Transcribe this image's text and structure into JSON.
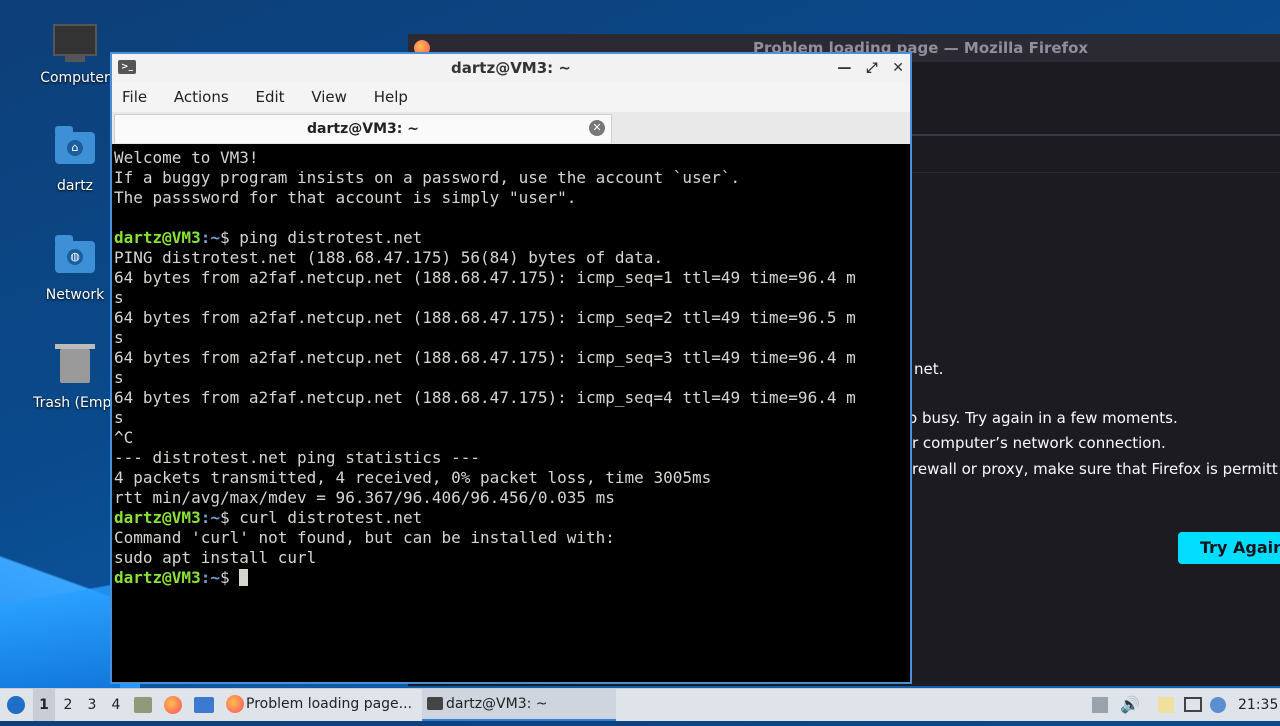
{
  "desktop": {
    "icons": [
      {
        "label": "Computer"
      },
      {
        "label": "dartz"
      },
      {
        "label": "Network"
      },
      {
        "label": "Trash (Empt"
      }
    ]
  },
  "firefox": {
    "title": "Problem loading page — Mozilla Firefox",
    "lines": [
      "net.",
      "o busy. Try again in a few moments.",
      "r computer’s network connection.",
      "rewall or proxy, make sure that Firefox is permitt"
    ],
    "try_again": "Try Again"
  },
  "terminal": {
    "title": "dartz@VM3: ~",
    "menu": [
      "File",
      "Actions",
      "Edit",
      "View",
      "Help"
    ],
    "tab_label": "dartz@VM3: ~",
    "prompt_user": "dartz@VM3",
    "prompt_path": ":~",
    "prompt_sym": "$ ",
    "lines": [
      {
        "t": "Welcome to VM3!"
      },
      {
        "t": "If a buggy program insists on a password, use the account `user`."
      },
      {
        "t": "The passsword for that account is simply \"user\"."
      },
      {
        "t": ""
      },
      {
        "p": true,
        "t": "ping distrotest.net"
      },
      {
        "t": "PING distrotest.net (188.68.47.175) 56(84) bytes of data."
      },
      {
        "t": "64 bytes from a2faf.netcup.net (188.68.47.175): icmp_seq=1 ttl=49 time=96.4 m"
      },
      {
        "t": "s"
      },
      {
        "t": "64 bytes from a2faf.netcup.net (188.68.47.175): icmp_seq=2 ttl=49 time=96.5 m"
      },
      {
        "t": "s"
      },
      {
        "t": "64 bytes from a2faf.netcup.net (188.68.47.175): icmp_seq=3 ttl=49 time=96.4 m"
      },
      {
        "t": "s"
      },
      {
        "t": "64 bytes from a2faf.netcup.net (188.68.47.175): icmp_seq=4 ttl=49 time=96.4 m"
      },
      {
        "t": "s"
      },
      {
        "t": "^C"
      },
      {
        "t": "--- distrotest.net ping statistics ---"
      },
      {
        "t": "4 packets transmitted, 4 received, 0% packet loss, time 3005ms"
      },
      {
        "t": "rtt min/avg/max/mdev = 96.367/96.406/96.456/0.035 ms"
      },
      {
        "p": true,
        "t": "curl distrotest.net"
      },
      {
        "t": "Command 'curl' not found, but can be installed with:"
      },
      {
        "t": "sudo apt install curl"
      },
      {
        "p": true,
        "t": "",
        "cursor": true
      }
    ]
  },
  "taskbar": {
    "workspaces": [
      "1",
      "2",
      "3",
      "4"
    ],
    "active_workspace": "1",
    "tasks": [
      {
        "label": "Problem loading page...",
        "icon": "firefox-icon"
      },
      {
        "label": "dartz@VM3: ~",
        "icon": "terminal-icon",
        "active": true
      }
    ],
    "clock": "21:35"
  },
  "colors": {
    "prompt_user": "#8ae234",
    "prompt_path": "#729fcf",
    "try_again_bg": "#00ddff",
    "window_border": "#4a90d9"
  }
}
